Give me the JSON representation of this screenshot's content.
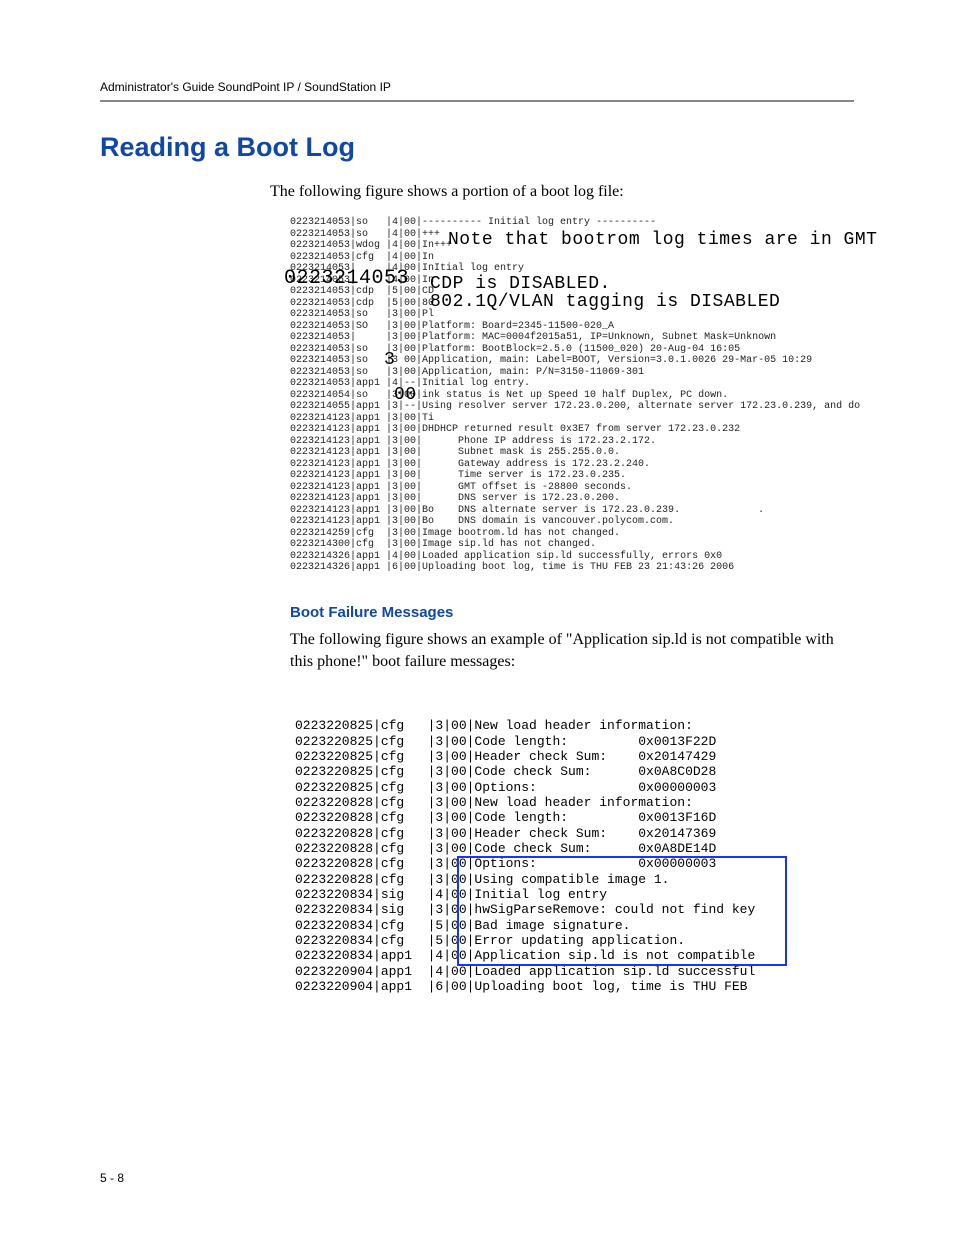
{
  "header": "Administrator's Guide SoundPoint IP / SoundStation IP",
  "title": "Reading a Boot Log",
  "intro": "The following figure shows a portion of a boot log file:",
  "boot_log": {
    "lines": [
      "0223214053|so   |4|00|---------- Initial log entry ----------",
      "0223214053|so   |4|00|+++",
      "0223214053|wdog |4|00|In+++",
      "0223214053|cfg  |4|00|In",
      "0223214053|     |4|00|InItial log entry",
      "0223214053|     |4|00|In",
      "0223214053|cdp  |5|00|CD",
      "0223214053|cdp  |5|00|80",
      "0223214053|so   |3|00|Pl",
      "0223214053|SO   |3|00|Platform: Board=2345-11500-020_A",
      "0223214053|     |3|00|Platform: MAC=0004f2015a51, IP=Unknown, Subnet Mask=Unknown",
      "0223214053|so   |3|00|Platform: BootBlock=2.5.0 (11500_020) 20-Aug-04 16:05",
      "0223214053|so   |3 00|Application, main: Label=BOOT, Version=3.0.1.0026 29-Mar-05 10:29",
      "0223214053|so   |3|00|Application, main: P/N=3150-11069-301",
      "0223214053|app1 |4|--|Initial log entry.",
      "0223214054|so   |3|00|ink status is Net up Speed 10 half Duplex, PC down.",
      "0223214055|app1 |3|--|Using resolver server 172.23.0.200, alternate server 172.23.0.239, and do",
      "0223214123|app1 |3|00|Ti",
      "0223214123|app1 |3|00|DHDHCP returned result 0x3E7 from server 172.23.0.232",
      "0223214123|app1 |3|00|      Phone IP address is 172.23.2.172.",
      "0223214123|app1 |3|00|      Subnet mask is 255.255.0.0.",
      "0223214123|app1 |3|00|      Gateway address is 172.23.2.240.",
      "0223214123|app1 |3|00|      Time server is 172.23.0.235.",
      "0223214123|app1 |3|00|      GMT offset is -28800 seconds.",
      "0223214123|app1 |3|00|      DNS server is 172.23.0.200.",
      "0223214123|app1 |3|00|Bo    DNS alternate server is 172.23.0.239.             .",
      "0223214123|app1 |3|00|Bo    DNS domain is vancouver.polycom.com.",
      "0223214259|cfg  |3|00|Image bootrom.ld has not changed.",
      "0223214300|cfg  |3|00|Image sip.ld has not changed.",
      "0223214326|app1 |4|00|Loaded application sip.ld successfully, errors 0x0",
      "0223214326|app1 |6|00|Uploading boot log, time is THU FEB 23 21:43:26 2006"
    ],
    "overlays": {
      "note": "Note that bootrom log times are in GMT",
      "ts": "0223214053",
      "cdp": "CDP is DISABLED.",
      "vlan": "802.1Q/VLAN tagging is DISABLED",
      "oo": "00",
      "three": "3"
    }
  },
  "sub_title": "Boot Failure Messages",
  "fail_intro": "The following figure shows an example of \"Application sip.ld is not compatible with this phone!\" boot failure messages:",
  "fail_log": {
    "lines": [
      "0223220825|cfg   |3|00|New load header information:",
      "0223220825|cfg   |3|00|Code length:         0x0013F22D",
      "0223220825|cfg   |3|00|Header check Sum:    0x20147429",
      "0223220825|cfg   |3|00|Code check Sum:      0x0A8C0D28",
      "0223220825|cfg   |3|00|Options:             0x00000003",
      "0223220828|cfg   |3|00|New load header information:",
      "0223220828|cfg   |3|00|Code length:         0x0013F16D",
      "0223220828|cfg   |3|00|Header check Sum:    0x20147369",
      "0223220828|cfg   |3|00|Code check Sum:      0x0A8DE14D",
      "0223220828|cfg   |3|00|Options:             0x00000003",
      "0223220828|cfg   |3|00|Using compatible image 1.",
      "0223220834|sig   |4|00|Initial log entry",
      "0223220834|sig   |3|00|hwSigParseRemove: could not find key",
      "0223220834|cfg   |5|00|Bad image signature.",
      "0223220834|cfg   |5|00|Error updating application.",
      "0223220834|app1  |4|00|Application sip.ld is not compatible",
      "0223220904|app1  |4|00|Loaded application sip.ld successful",
      "0223220904|app1  |6|00|Uploading boot log, time is THU FEB "
    ]
  },
  "page_number": "5 - 8"
}
